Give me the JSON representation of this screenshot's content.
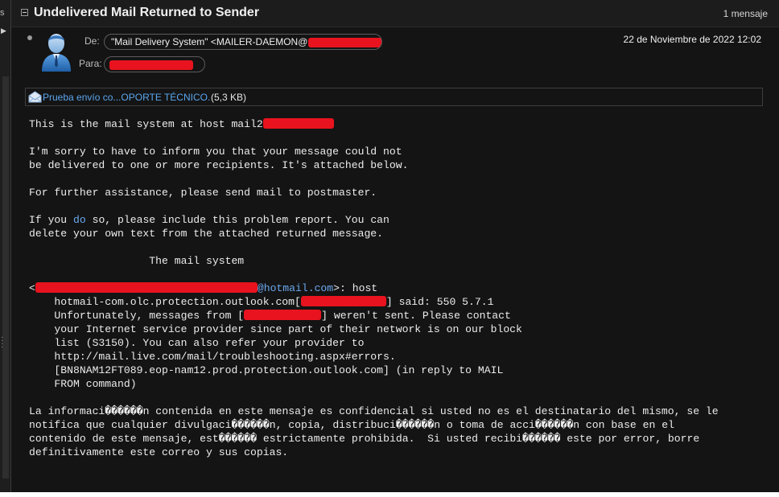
{
  "left_pane": {
    "glyph": "s",
    "caret": "▶"
  },
  "message": {
    "subject": "Undelivered Mail Returned to Sender",
    "count_label": "1 mensaje"
  },
  "header": {
    "from_label": "De:",
    "from_value": "\"Mail Delivery System\" <MAILER-DAEMON@",
    "to_label": "Para:",
    "date": "22 de Noviembre de 2022 12:02"
  },
  "attachment": {
    "name": "Prueba envío co...OPORTE TÉCNICO.",
    "size": "(5,3 KB)"
  },
  "body": {
    "host_line": "This is the mail system at host mail2",
    "sorry_1": "I'm sorry to have to inform you that your message could not",
    "sorry_2": "be delivered to one or more recipients. It's attached below.",
    "assist": "For further assistance, please send mail to postmaster.",
    "if_pre": "If you ",
    "if_do": "do",
    "if_post": " so, please include this problem report. You can",
    "delete_line": "delete your own text from the attached returned message.",
    "signature": "                   The mail system",
    "rcpt_start": "<",
    "rcpt_domain": "@hotmail.com",
    "rcpt_end": ">: host",
    "err_1": "    hotmail-com.olc.protection.outlook.com[",
    "err_1b": "] said: 550 5.7.1",
    "err_2": "    Unfortunately, messages from [",
    "err_2b": "] weren't sent. Please contact",
    "err_3": "    your Internet service provider since part of their network is on our block",
    "err_4": "    list (S3150). You can also refer your provider to",
    "err_5": "    http://mail.live.com/mail/troubleshooting.aspx#errors.",
    "err_6": "    [BN8NAM12FT089.eop-nam12.prod.protection.outlook.com] (in reply to MAIL",
    "err_7": "    FROM command)",
    "disc_1": "La informaci������n contenida en este mensaje es confidencial si usted no es el destinatario del mismo, se le",
    "disc_2": "notifica que cualquier divulgaci������n, copia, distribuci������n o toma de acci������n con base en el",
    "disc_3": "contenido de este mensaje, est������ estrictamente prohibida.  Si usted recibi������ este por error, borre",
    "disc_4": "definitivamente este correo y sus copias."
  },
  "colors": {
    "background": "#141414",
    "link": "#5aa6ee",
    "redaction": "#e8131e"
  },
  "icons": [
    "avatar-icon",
    "attachment-envelope-icon",
    "collapse-icon"
  ]
}
